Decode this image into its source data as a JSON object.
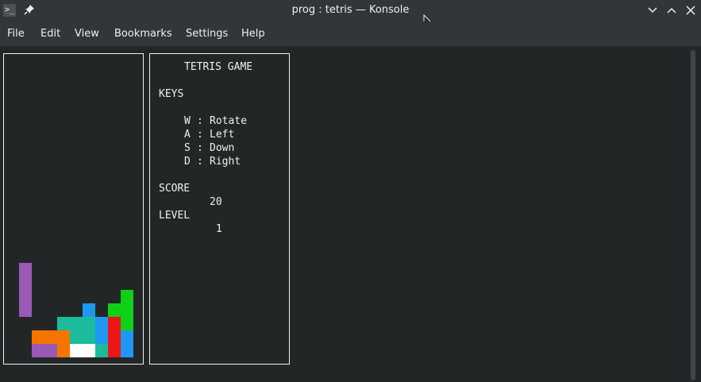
{
  "window": {
    "title": "prog : tetris — Konsole",
    "app_icon": "konsole-icon"
  },
  "menu": [
    "File",
    "Edit",
    "View",
    "Bookmarks",
    "Settings",
    "Help"
  ],
  "game": {
    "heading": "TETRIS GAME",
    "keys_heading": "KEYS",
    "keys": [
      {
        "key": "W",
        "action": "Rotate"
      },
      {
        "key": "A",
        "action": "Left"
      },
      {
        "key": "S",
        "action": "Down"
      },
      {
        "key": "D",
        "action": "Right"
      }
    ],
    "score_label": "SCORE",
    "score": "20",
    "level_label": "LEVEL",
    "level": "1"
  },
  "board": {
    "colors": {
      "purple": "#9b59b6",
      "orange": "#f67400",
      "teal": "#1abc9c",
      "blue": "#1d99f3",
      "red": "#ed1515",
      "green": "#11d116",
      "white": "#ffffff"
    }
  }
}
